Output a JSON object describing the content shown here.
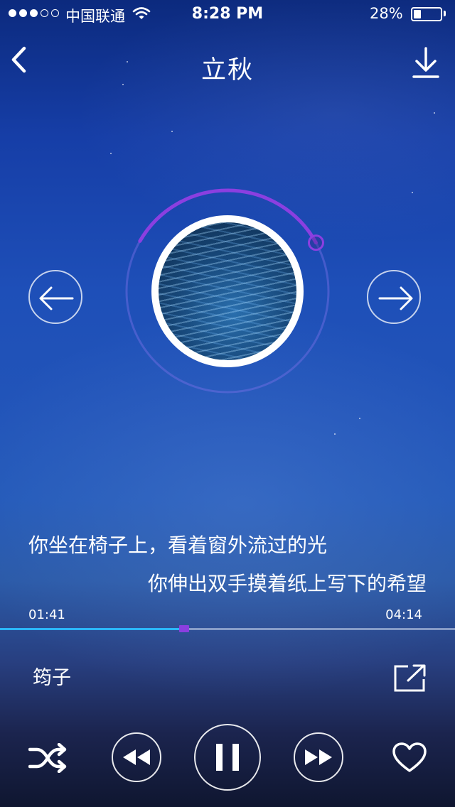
{
  "status_bar": {
    "carrier": "中国联通",
    "time": "8:28 PM",
    "battery_percent": "28%",
    "battery_level": 0.28,
    "signal_bars_filled": 3,
    "signal_bars_total": 5
  },
  "header": {
    "title": "立秋"
  },
  "player": {
    "playback_progress": 0.405,
    "lyrics": [
      "你坐在椅子上，看着窗外流过的光",
      "你伸出双手摸着纸上写下的希望"
    ],
    "time_elapsed": "01:41",
    "time_total": "04:14",
    "artist": "筠子",
    "is_playing": true
  },
  "colors": {
    "accent_purple": "#8b3fe0",
    "progress_blue": "#2bb6ff"
  },
  "icons": {
    "back": "chevron-left-icon",
    "download": "download-icon",
    "prev_song": "arrow-left-icon",
    "next_song": "arrow-right-icon",
    "share": "share-icon",
    "shuffle": "shuffle-icon",
    "rewind": "rewind-icon",
    "pause": "pause-icon",
    "forward": "fast-forward-icon",
    "favorite": "heart-icon"
  }
}
